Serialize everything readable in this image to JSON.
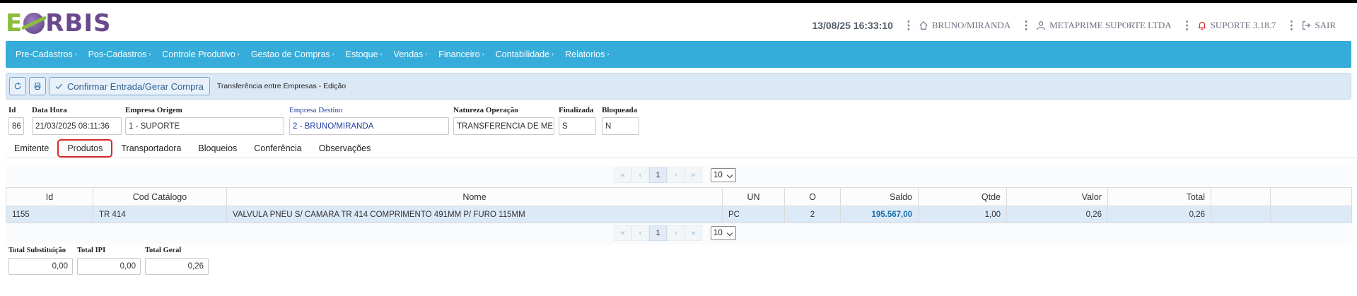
{
  "header": {
    "logo_e": "E",
    "logo_rest": "RBIS",
    "datetime": "13/08/25 16:33:10",
    "branch": "BRUNO/MIRANDA",
    "company": "METAPRIME SUPORTE LTDA",
    "support": "SUPORTE 3.18.7",
    "logout": "SAIR",
    "icons": {
      "home": "home-icon",
      "user": "user-icon",
      "bell": "bell-icon",
      "logout": "logout-icon"
    }
  },
  "nav": {
    "items": [
      "Pre-Cadastros",
      "Pos-Cadastros",
      "Controle Produtivo",
      "Gestao de Compras",
      "Estoque",
      "Vendas",
      "Financeiro",
      "Contabilidade",
      "Relatorios"
    ]
  },
  "toolbar": {
    "confirm_label": "Confirmar Entrada/Gerar Compra",
    "title": "Transferência entre Empresas - Edição"
  },
  "form": {
    "id_label": "Id",
    "id_value": "86",
    "datahora_label": "Data Hora",
    "datahora_value": "21/03/2025 08:11:36",
    "origem_label": "Empresa Origem",
    "origem_value": "1 - SUPORTE",
    "destino_label": "Empresa Destino",
    "destino_value": "2 - BRUNO/MIRANDA",
    "natureza_label": "Natureza Operação",
    "natureza_value": "TRANSFERENCIA DE MERCADORIA",
    "finalizada_label": "Finalizada",
    "finalizada_value": "S",
    "bloqueada_label": "Bloqueada",
    "bloqueada_value": "N"
  },
  "tabs": [
    "Emitente",
    "Produtos",
    "Transportadora",
    "Bloqueios",
    "Conferência",
    "Observações"
  ],
  "active_tab": "Produtos",
  "pager": {
    "first": "«",
    "prev": "‹",
    "page": "1",
    "next": "›",
    "last": "»",
    "page_size": "10"
  },
  "table": {
    "columns": [
      "Id",
      "Cod Catálogo",
      "Nome",
      "UN",
      "O",
      "Saldo",
      "Qtde",
      "Valor",
      "Total",
      "",
      ""
    ],
    "rows": [
      {
        "id": "1155",
        "cod": "TR 414",
        "nome": "VALVULA PNEU S/ CAMARA TR 414 COMPRIMENTO 491MM P/ FURO 115MM",
        "un": "PC",
        "o": "2",
        "saldo": "195.567,00",
        "qtde": "1,00",
        "valor": "0,26",
        "total": "0,26"
      }
    ]
  },
  "totals": {
    "subst_label": "Total Substituição",
    "subst_value": "0,00",
    "ipi_label": "Total IPI",
    "ipi_value": "0,00",
    "geral_label": "Total Geral",
    "geral_value": "0,26"
  },
  "colors": {
    "nav": "#35acd9",
    "toolbar": "#dbe8f5",
    "row_selected": "#dceaf7",
    "saldo": "#1a6ea8",
    "active_tab_border": "#d9292c"
  }
}
